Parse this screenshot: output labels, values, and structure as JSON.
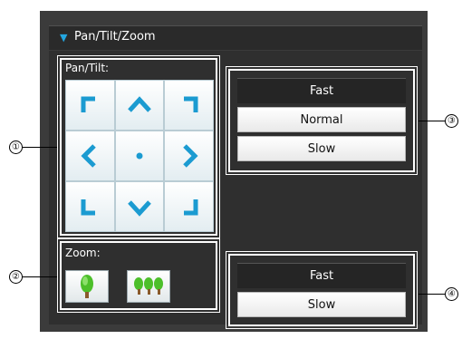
{
  "panel": {
    "title": "Pan/Tilt/Zoom",
    "accent": "#23a6e0"
  },
  "pantilt": {
    "label": "Pan/Tilt:",
    "buttons": [
      {
        "name": "up-left",
        "icon": "arrow-up-left-icon"
      },
      {
        "name": "up",
        "icon": "arrow-up-icon"
      },
      {
        "name": "up-right",
        "icon": "arrow-up-right-icon"
      },
      {
        "name": "left",
        "icon": "arrow-left-icon"
      },
      {
        "name": "home",
        "icon": "center-dot-icon"
      },
      {
        "name": "right",
        "icon": "arrow-right-icon"
      },
      {
        "name": "down-left",
        "icon": "arrow-down-left-icon"
      },
      {
        "name": "down",
        "icon": "arrow-down-icon"
      },
      {
        "name": "down-right",
        "icon": "arrow-down-right-icon"
      }
    ]
  },
  "zoom": {
    "label": "Zoom:",
    "in_icon": "single-tree-icon",
    "out_icon": "three-trees-icon"
  },
  "pantilt_speed": {
    "options": [
      "Fast",
      "Normal",
      "Slow"
    ],
    "selected": "Fast"
  },
  "zoom_speed": {
    "options": [
      "Fast",
      "Slow"
    ],
    "selected": "Fast"
  },
  "callouts": [
    "①",
    "②",
    "③",
    "④"
  ]
}
